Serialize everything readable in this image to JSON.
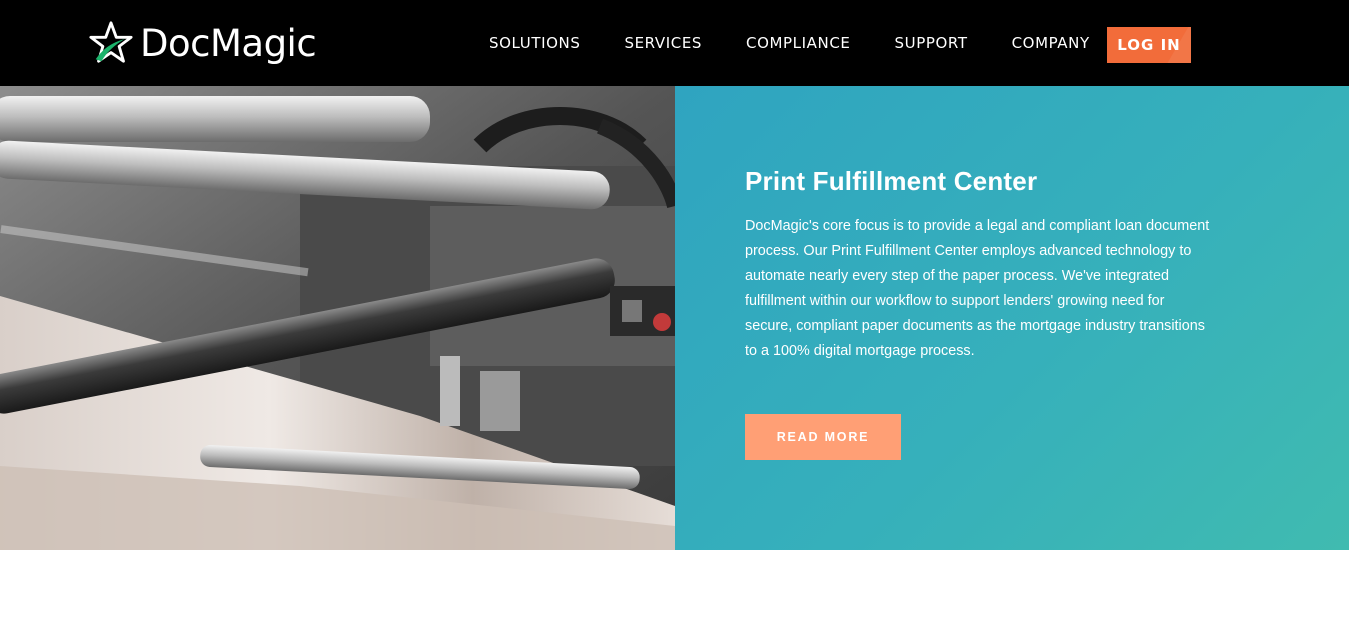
{
  "header": {
    "logo_text": "DocMagic",
    "logo_icon": "star-logo-icon",
    "nav": [
      {
        "label": "SOLUTIONS"
      },
      {
        "label": "SERVICES"
      },
      {
        "label": "COMPLIANCE"
      },
      {
        "label": "SUPPORT"
      },
      {
        "label": "COMPANY"
      }
    ],
    "login_label": "LOG IN"
  },
  "hero": {
    "title": "Print Fulfillment Center",
    "body": "DocMagic's core focus is to provide a legal and compliant loan document process. Our Print Fulfillment Center employs advanced technology to automate nearly every step of the paper process. We've integrated fulfillment within our workflow to support lenders' growing need for secure, compliant paper documents as the mortgage industry transitions to a 100% digital mortgage process.",
    "button_label": "READ MORE",
    "image": "printing-press-photo"
  },
  "colors": {
    "header_bg": "#000000",
    "accent_orange": "#f26c3a",
    "button_orange": "#ff9f75",
    "panel_teal": "#36b0bb",
    "logo_green": "#1bb36b"
  }
}
